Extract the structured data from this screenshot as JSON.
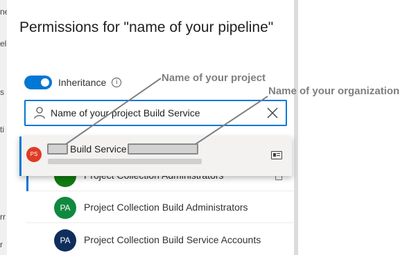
{
  "background": {
    "left_fragments": [
      "ne",
      "el",
      "s",
      "ti",
      "rr",
      "r"
    ]
  },
  "dialog": {
    "title": "Permissions for \"name of your pipeline\"",
    "inheritance": {
      "label": "Inheritance",
      "enabled": true,
      "info_icon": "info-icon"
    },
    "search": {
      "value": "Name of your project Build Service",
      "icon": "person-icon",
      "clear_icon": "close-icon"
    },
    "suggestion": {
      "avatar_initials": "PS",
      "title": "Build Service",
      "icon": "contact-card-icon"
    },
    "list": [
      {
        "label": "Project Collection Administrators",
        "initials": "",
        "color": "#107c10"
      },
      {
        "label": "Project Collection Build Administrators",
        "initials": "PA",
        "color": "#10893e"
      },
      {
        "label": "Project Collection Build Service Accounts",
        "initials": "PA",
        "color": "#0f2e5c"
      }
    ]
  },
  "annotations": {
    "project": "Name of your project",
    "organization": "Name of your organization"
  },
  "colors": {
    "accent": "#0078d4",
    "annotation": "#7f7f7f",
    "suggestion_avatar": "#e03b24"
  }
}
